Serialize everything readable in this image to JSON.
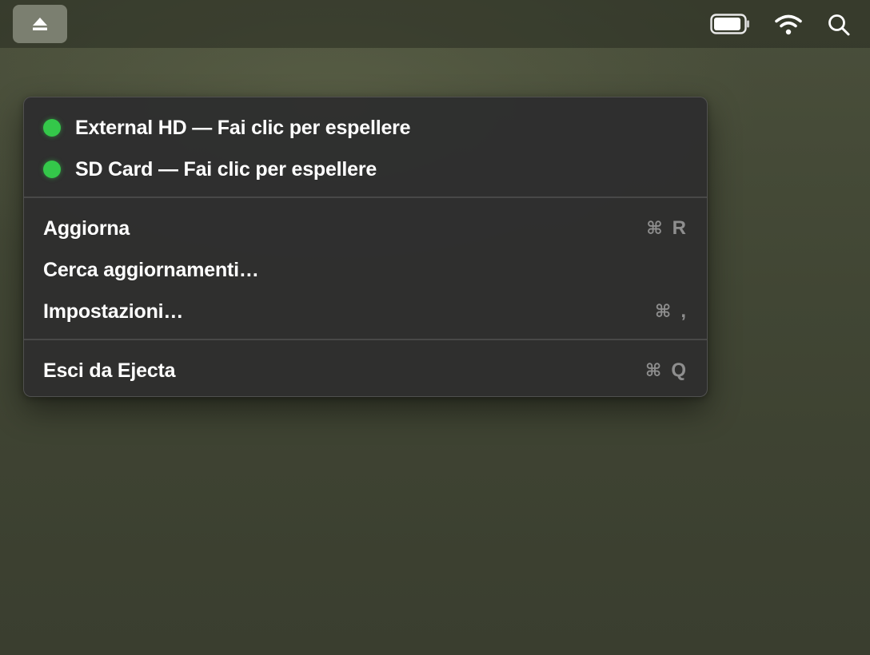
{
  "menubar": {
    "app_icon": "eject-icon",
    "status_icons": [
      "battery-icon",
      "wifi-icon",
      "search-icon"
    ]
  },
  "menu": {
    "drives": [
      {
        "label": "External HD — Fai clic per espellere",
        "status_color": "#34c84a"
      },
      {
        "label": "SD Card — Fai clic per espellere",
        "status_color": "#34c84a"
      }
    ],
    "actions": [
      {
        "label": "Aggiorna",
        "shortcut_symbol": "⌘",
        "shortcut_key": "R"
      },
      {
        "label": "Cerca aggiornamenti…",
        "shortcut_symbol": "",
        "shortcut_key": ""
      },
      {
        "label": "Impostazioni…",
        "shortcut_symbol": "⌘",
        "shortcut_key": ","
      }
    ],
    "quit": {
      "label": "Esci da Ejecta",
      "shortcut_symbol": "⌘",
      "shortcut_key": "Q"
    }
  },
  "colors": {
    "menu_background": "#2e2e2e",
    "accent_green": "#34c84a",
    "shortcut_text": "#8e8e8e"
  }
}
